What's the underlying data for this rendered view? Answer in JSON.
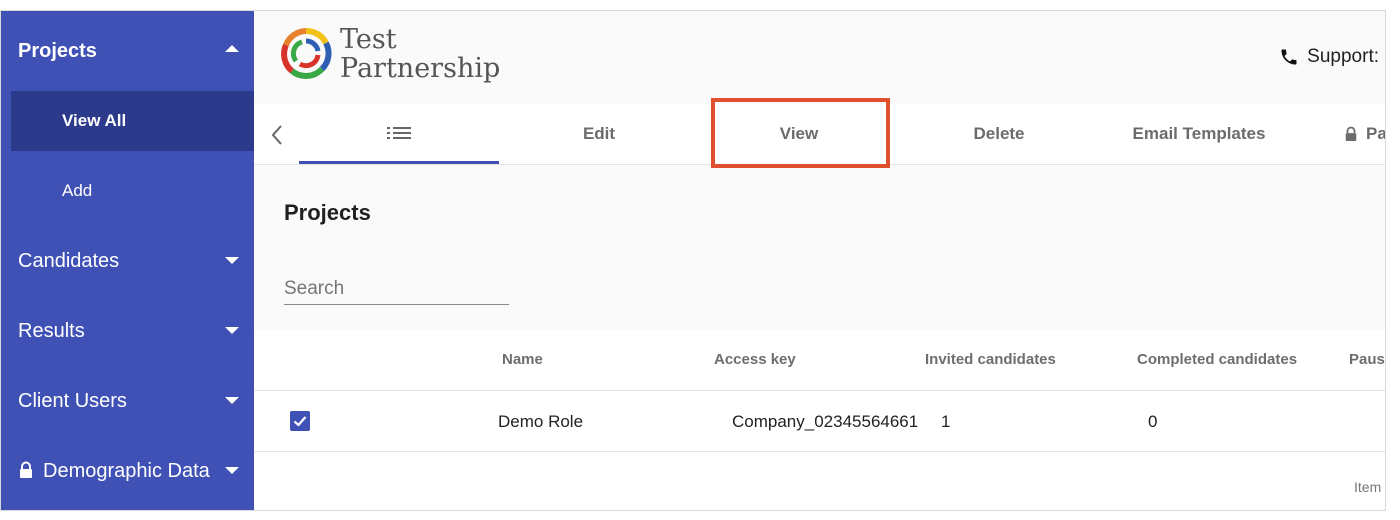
{
  "sidebar": {
    "items": [
      {
        "label": "Projects",
        "expanded": true
      },
      {
        "label": "View All",
        "active": true
      },
      {
        "label": "Add"
      },
      {
        "label": "Candidates"
      },
      {
        "label": "Results"
      },
      {
        "label": "Client Users"
      },
      {
        "label": "Demographic Data",
        "locked": true
      }
    ]
  },
  "header": {
    "brand_line1": "Test",
    "brand_line2": "Partnership",
    "support_label": "Support:"
  },
  "tabs": [
    {
      "label": "",
      "icon": "list-icon",
      "active": true
    },
    {
      "label": "Edit"
    },
    {
      "label": "View",
      "highlighted": true
    },
    {
      "label": "Delete"
    },
    {
      "label": "Email Templates"
    },
    {
      "label": "Pa",
      "locked": true
    }
  ],
  "content": {
    "title": "Projects",
    "search_placeholder": "Search"
  },
  "table": {
    "columns": [
      "Name",
      "Access key",
      "Invited candidates",
      "Completed candidates",
      "Pause"
    ],
    "rows": [
      {
        "checked": true,
        "name": "Demo Role",
        "access_key": "Company_02345564661",
        "invited": "1",
        "completed": "0"
      }
    ],
    "footer": "Item"
  },
  "colors": {
    "sidebar_bg": "#3f51b5",
    "sidebar_active": "#2b3a8a",
    "highlight": "#e0502f",
    "accent": "#3f51b5"
  }
}
